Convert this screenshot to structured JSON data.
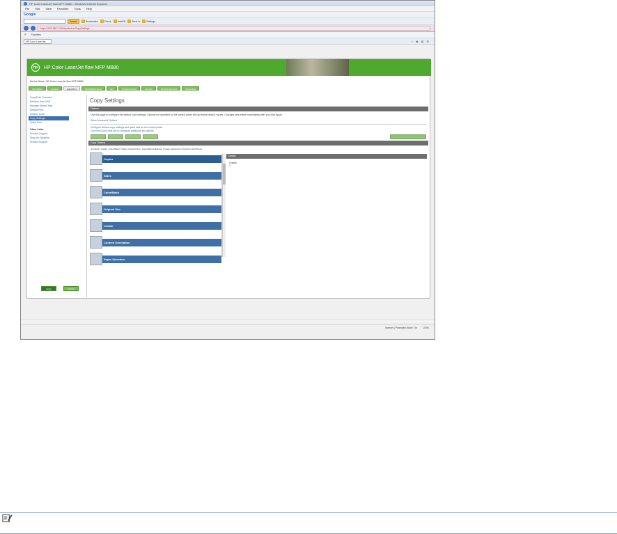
{
  "browser": {
    "title": "HP Color LaserJet flow MFP M880 - Windows Internet Explorer",
    "menu": [
      "File",
      "Edit",
      "View",
      "Favorites",
      "Tools",
      "Help"
    ],
    "google_label": "Google",
    "search_button": "Search",
    "toolbar_chips": [
      "Bookmarks",
      "Check",
      "AutoFill",
      "Send to",
      "Settings"
    ],
    "url": "https://192.168.1.100/hp/device/CopySettings",
    "favorites_label": "Favorites",
    "tab_label": "HP Color LaserJet"
  },
  "header": {
    "logo": "hp",
    "title": "HP Color LaserJet flow MFP M880"
  },
  "device_line": "Device Name: HP Color LaserJet flow MFP M880",
  "nav_tabs": [
    "Information",
    "General",
    "Copy/Print",
    "Scan/Digital Send",
    "Fax",
    "Troubleshooting",
    "Security",
    "HP Web Services",
    "Networking"
  ],
  "active_tab": "Copy/Print",
  "sidebar": {
    "items": [
      "Copy/Print Overview",
      "Retrieve from USB",
      "Manage Stored Jobs",
      "Default Print",
      "Restrict Color",
      "Copy Settings",
      "Quick Sets"
    ],
    "selected": "Copy Settings",
    "section": "Other Links",
    "links": [
      "Product Support",
      "Shop for Supplies",
      "Product Support"
    ]
  },
  "main": {
    "page_title": "Copy Settings",
    "section1": "Options",
    "paragraph": "Use this page to configure the default copy settings. Options not specified on the control panel will use these default values. Changes take effect immediately after you click Apply.",
    "link1": "Show Advanced Options",
    "link2": "Configure default copy settings and quick sets on the control panel.",
    "link3": "Click the Quick Sets link to configure additional job options.",
    "section2": "Copy Options",
    "filters": "Job Build | Collate | Color/Black | Sides | Original Size | Copy/Reduce/Enlarge | Image Adjustment | Optimize Text/Picture",
    "options": [
      "Copies",
      "Sides",
      "Color/Black",
      "Original Size",
      "Collate",
      "Content Orientation",
      "Paper Selection"
    ],
    "details_head": "Details",
    "details": [
      "Copies",
      "1"
    ]
  },
  "buttons": {
    "apply": "Apply",
    "cancel": "Cancel"
  },
  "statusbar": [
    "Internet | Protected Mode: On",
    "100%"
  ]
}
